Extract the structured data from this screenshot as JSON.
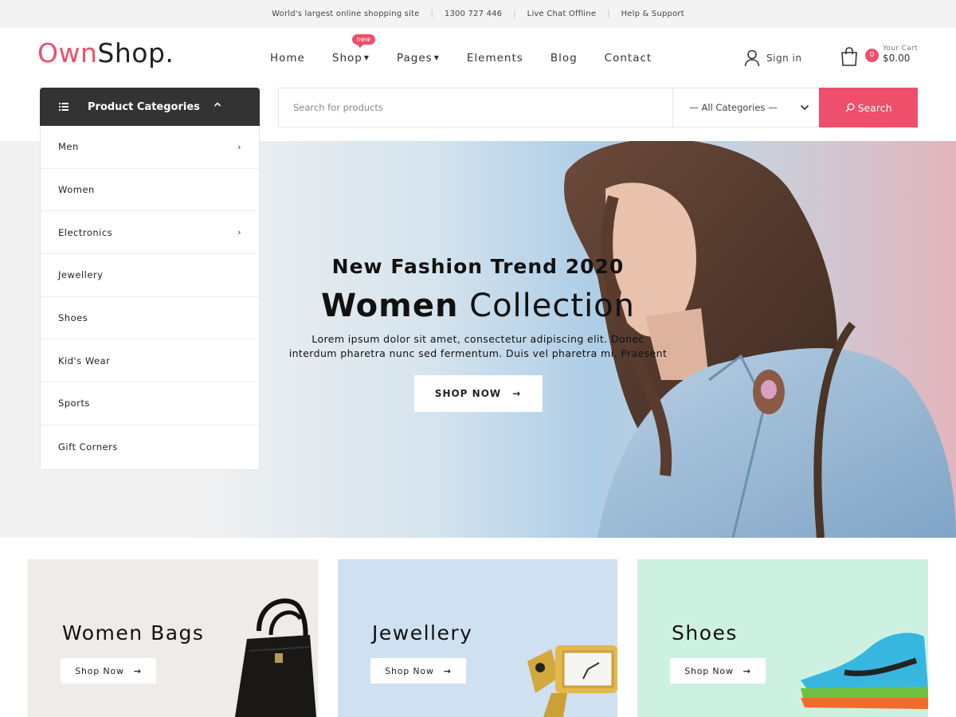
{
  "topbar": {
    "tagline": "World's largest online shopping site",
    "phone": "1300 727 446",
    "chat": "Live Chat Offline",
    "help": "Help & Support"
  },
  "logo": {
    "part1": "Own",
    "part2": "Shop."
  },
  "nav": {
    "items": [
      {
        "label": "Home"
      },
      {
        "label": "Shop",
        "dropdown": true,
        "badge": "new"
      },
      {
        "label": "Pages",
        "dropdown": true
      },
      {
        "label": "Elements"
      },
      {
        "label": "Blog"
      },
      {
        "label": "Contact"
      }
    ]
  },
  "account": {
    "signin": "Sign in",
    "icon": "user-icon"
  },
  "cart": {
    "count": "0",
    "label": "Your Cart",
    "amount": "$0.00",
    "icon": "shopping-bag-icon"
  },
  "categories": {
    "title": "Product Categories",
    "items": [
      {
        "label": "Men",
        "has_sub": true
      },
      {
        "label": "Women",
        "has_sub": false
      },
      {
        "label": "Electronics",
        "has_sub": true
      },
      {
        "label": "Jewellery",
        "has_sub": false
      },
      {
        "label": "Shoes",
        "has_sub": false
      },
      {
        "label": "Kid's Wear",
        "has_sub": false
      },
      {
        "label": "Sports",
        "has_sub": false
      },
      {
        "label": "Gift Corners",
        "has_sub": false
      }
    ]
  },
  "search": {
    "placeholder": "Search for products",
    "category_selected": "— All Categories —",
    "button": "Search"
  },
  "hero": {
    "subtitle": "New Fashion Trend 2020",
    "title_bold": "Women",
    "title_light": "Collection",
    "description": "Lorem ipsum dolor sit amet, consectetur adipiscing elit. Donec interdum pharetra nunc sed fermentum. Duis vel pharetra mi. Praesent",
    "button": "SHOP NOW"
  },
  "promos": [
    {
      "title": "Women Bags",
      "button": "Shop Now",
      "bg": "#efebe8"
    },
    {
      "title": "Jewellery",
      "button": "Shop Now",
      "bg": "#cfe0f1"
    },
    {
      "title": "Shoes",
      "button": "Shop Now",
      "bg": "#cdf1e1"
    }
  ],
  "colors": {
    "accent": "#ee4f6a",
    "dark": "#333333"
  }
}
